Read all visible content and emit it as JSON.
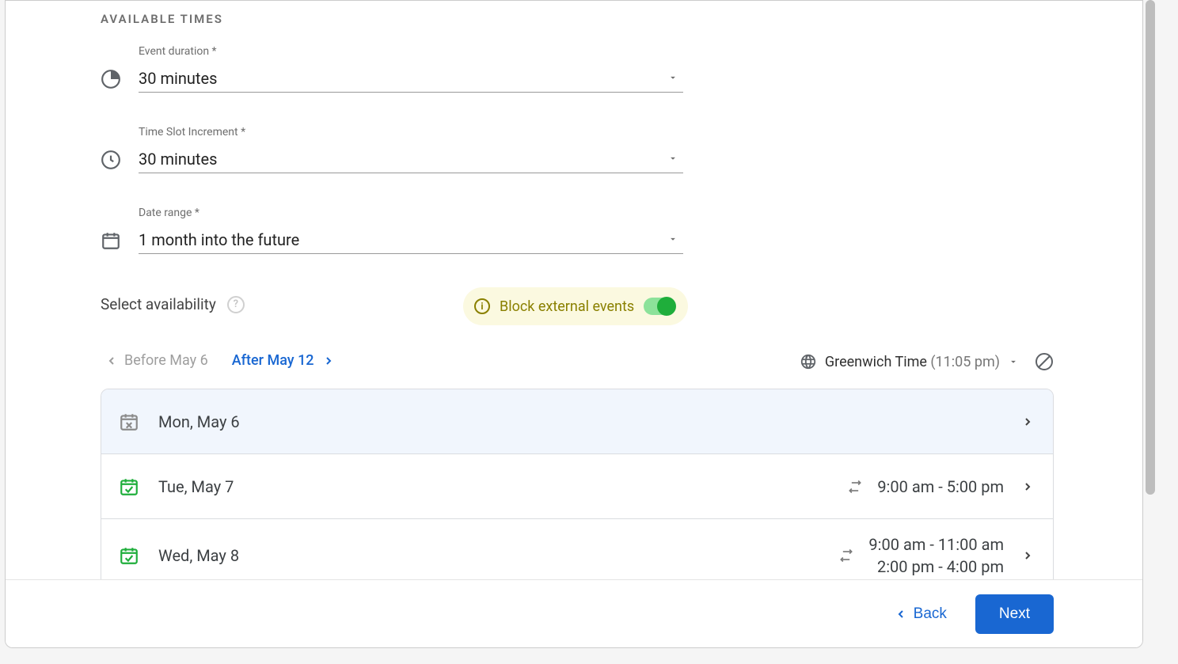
{
  "section_title": "AVAILABLE TIMES",
  "fields": {
    "duration": {
      "label": "Event duration *",
      "value": "30 minutes"
    },
    "increment": {
      "label": "Time Slot Increment *",
      "value": "30 minutes"
    },
    "date_range": {
      "label": "Date range *",
      "value": "1 month into the future"
    }
  },
  "availability_label": "Select availability",
  "block_external_label": "Block external events",
  "nav": {
    "before": "Before May 6",
    "after": "After May 12"
  },
  "timezone": {
    "name": "Greenwich Time",
    "time": "(11:05 pm)"
  },
  "days": [
    {
      "label": "Mon, May 6",
      "type": "empty",
      "slots": []
    },
    {
      "label": "Tue, May 7",
      "type": "active",
      "slots": [
        "9:00 am - 5:00 pm"
      ]
    },
    {
      "label": "Wed, May 8",
      "type": "active",
      "slots": [
        "9:00 am - 11:00 am",
        "2:00 pm - 4:00 pm"
      ]
    }
  ],
  "footer": {
    "back": "Back",
    "next": "Next"
  }
}
